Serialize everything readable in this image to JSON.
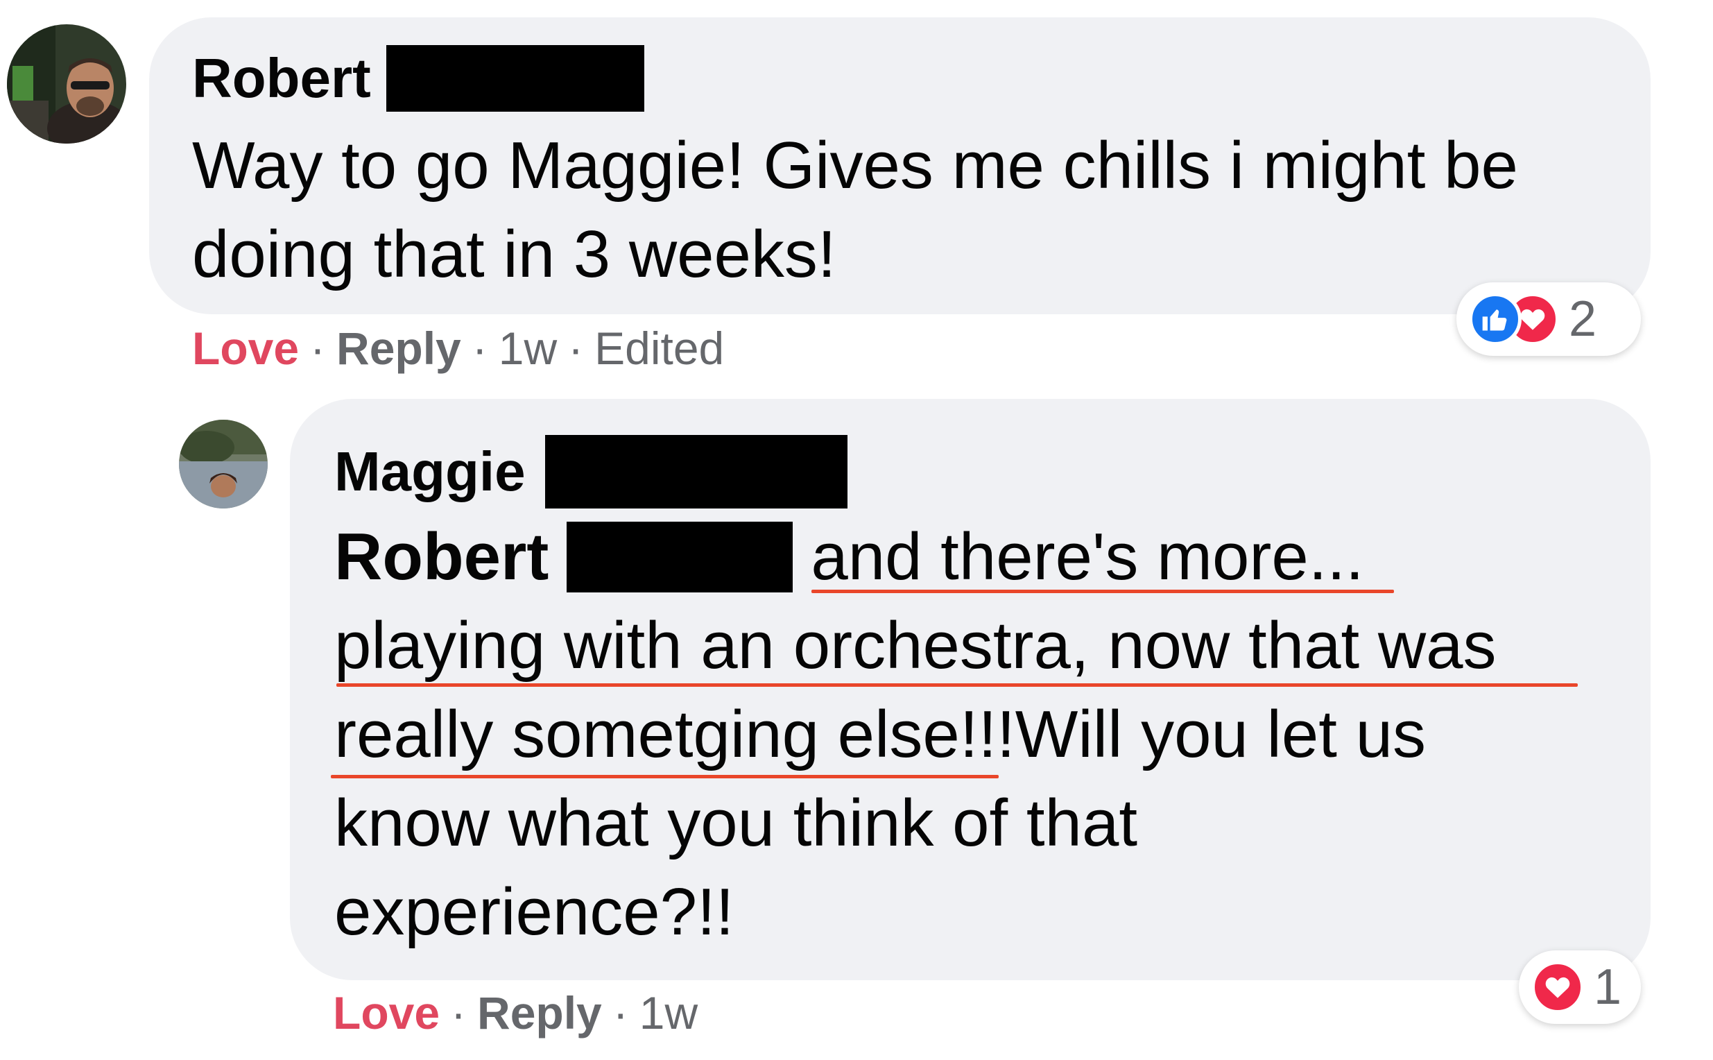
{
  "comments": [
    {
      "author": "Robert",
      "text_lines": [
        "Way to go Maggie! Gives me chills i might be",
        "doing that in 3 weeks!"
      ],
      "actions": {
        "love": "Love",
        "reply": "Reply",
        "time": "1w",
        "edited": "Edited",
        "separator": "·"
      },
      "reactions": {
        "icons": [
          "like-icon",
          "love-icon"
        ],
        "count": "2"
      }
    },
    {
      "author": "Maggie",
      "mention": "Robert",
      "text_lines": [
        "and there's more...",
        "playing with an orchestra, now that was",
        "really sometging else!!!Will you let us",
        "know what you think of that",
        "experience?!!"
      ],
      "actions": {
        "love": "Love",
        "reply": "Reply",
        "time": "1w",
        "separator": "·"
      },
      "reactions": {
        "icons": [
          "love-icon"
        ],
        "count": "1"
      }
    }
  ],
  "colors": {
    "bubble_bg": "#f0f1f4",
    "love_action": "#e0475f",
    "secondary_text": "#65676b",
    "spellcheck_underline": "#e9462a",
    "like_blue": "#1877f2",
    "love_red": "#f0284a"
  }
}
